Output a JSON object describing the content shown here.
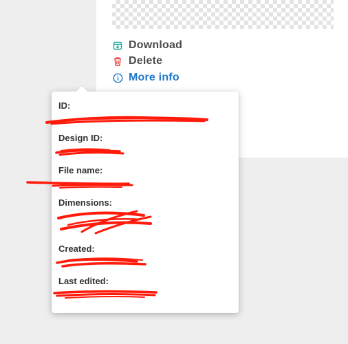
{
  "actions": {
    "download_label": "Download",
    "delete_label": "Delete",
    "more_info_label": "More info",
    "icons": {
      "download": "download-icon",
      "delete": "trash-icon",
      "more_info": "info-icon"
    }
  },
  "info_panel": {
    "id_label": "ID:",
    "design_id_label": "Design ID:",
    "file_name_label": "File name:",
    "dimensions_label": "Dimensions:",
    "created_label": "Created:",
    "last_edited_label": "Last edited:"
  },
  "colors": {
    "teal": "#1aa8a0",
    "red": "#e23b3b",
    "blue": "#1f77c9",
    "redaction": "#ff1a0a"
  }
}
